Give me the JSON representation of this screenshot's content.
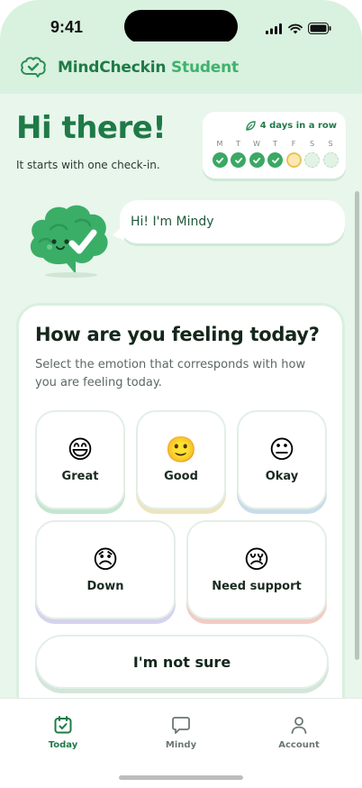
{
  "status_bar": {
    "time": "9:41"
  },
  "header": {
    "brand": "MindCheckin",
    "accent": "Student"
  },
  "greeting": {
    "title": "Hi there!",
    "subtitle": "It starts with one check-in."
  },
  "streak": {
    "label": "4 days in a row",
    "days": [
      {
        "letter": "M",
        "state": "done"
      },
      {
        "letter": "T",
        "state": "done"
      },
      {
        "letter": "W",
        "state": "done"
      },
      {
        "letter": "T",
        "state": "done"
      },
      {
        "letter": "F",
        "state": "today"
      },
      {
        "letter": "S",
        "state": "future"
      },
      {
        "letter": "S",
        "state": "future"
      }
    ]
  },
  "mascot": {
    "greeting": "Hi! I'm Mindy"
  },
  "feeling": {
    "title": "How are you feeling today?",
    "subtitle": "Select the emotion that corresponds with how you are feeling today.",
    "options": [
      {
        "label": "Great",
        "emoji": "😄"
      },
      {
        "label": "Good",
        "emoji": "🙂"
      },
      {
        "label": "Okay",
        "emoji": "😐"
      },
      {
        "label": "Down",
        "emoji": "😞"
      },
      {
        "label": "Need support",
        "emoji": "😢"
      }
    ],
    "not_sure": "I'm not sure"
  },
  "tabs": [
    {
      "label": "Today",
      "icon": "calendar-check-icon",
      "active": true
    },
    {
      "label": "Mindy",
      "icon": "chat-bubble-icon",
      "active": false
    },
    {
      "label": "Account",
      "icon": "person-icon",
      "active": false
    }
  ],
  "colors": {
    "brand": "#1f7a47",
    "accent": "#3fb36b",
    "background": "#e8f6ec"
  }
}
